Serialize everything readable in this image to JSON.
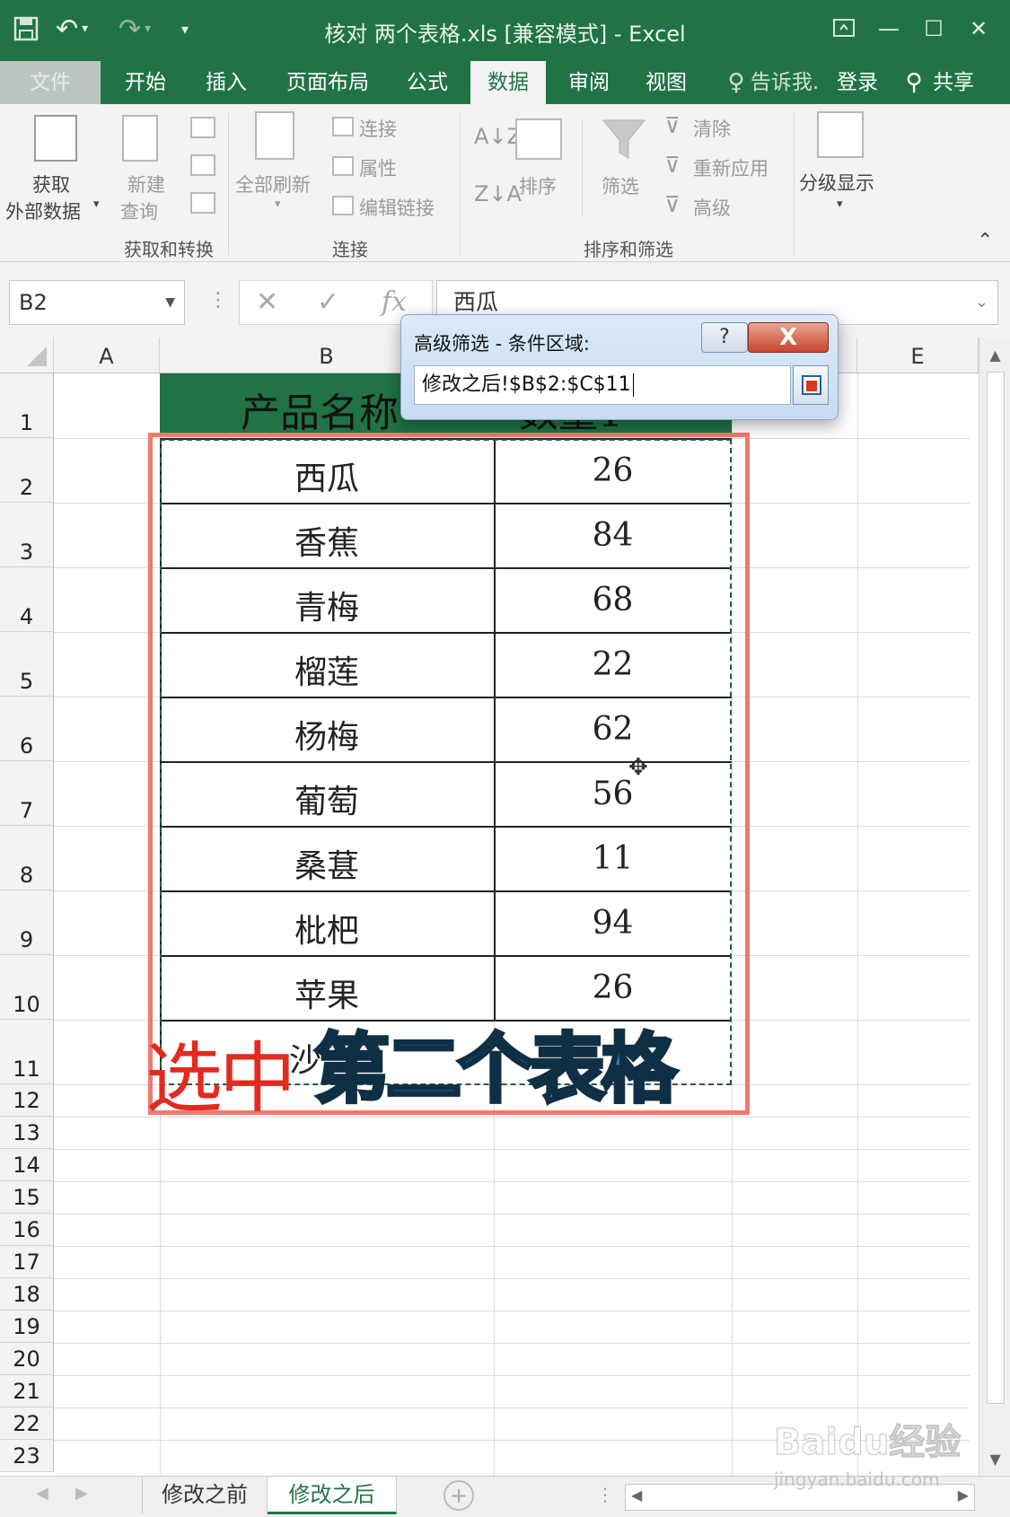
{
  "window": {
    "title": "核对 两个表格.xls  [兼容模式] - Excel",
    "controls": [
      "restore-icon",
      "minimize-icon",
      "maximize-icon",
      "close-icon"
    ]
  },
  "ribbon_tabs": [
    {
      "label": "文件",
      "state": "file"
    },
    {
      "label": "开始"
    },
    {
      "label": "插入"
    },
    {
      "label": "页面布局"
    },
    {
      "label": "公式"
    },
    {
      "label": "数据",
      "state": "active"
    },
    {
      "label": "审阅"
    },
    {
      "label": "视图"
    }
  ],
  "tell_me": "告诉我.",
  "login": "登录",
  "share": "共享",
  "ribbon": {
    "get_external": [
      "获取",
      "外部数据"
    ],
    "new_query": [
      "新建",
      "查询"
    ],
    "group_get_transform": "获取和转换",
    "refresh_all": "全部刷新",
    "connections": "连接",
    "properties": "属性",
    "edit_links": "编辑链接",
    "group_connections": "连接",
    "sort": "排序",
    "filter": "筛选",
    "clear": "清除",
    "reapply": "重新应用",
    "advanced": "高级",
    "group_sort_filter": "排序和筛选",
    "outline": "分级显示"
  },
  "formula_bar": {
    "name_box": "B2",
    "content": "西瓜",
    "fx": "fx"
  },
  "columns": [
    "A",
    "B",
    "C",
    "D",
    "E"
  ],
  "rows": [
    "1",
    "2",
    "3",
    "4",
    "5",
    "6",
    "7",
    "8",
    "9",
    "10",
    "11",
    "12",
    "13",
    "14",
    "15",
    "16",
    "17",
    "18",
    "19",
    "20",
    "21",
    "22",
    "23"
  ],
  "table": {
    "header_name": "产品名称",
    "header_qty": "数量1",
    "rows": [
      {
        "name": "西瓜",
        "qty": "26"
      },
      {
        "name": "香蕉",
        "qty": "84"
      },
      {
        "name": "青梅",
        "qty": "68"
      },
      {
        "name": "榴莲",
        "qty": "22"
      },
      {
        "name": "杨梅",
        "qty": "62"
      },
      {
        "name": "葡萄",
        "qty": "56"
      },
      {
        "name": "桑葚",
        "qty": "11"
      },
      {
        "name": "枇杷",
        "qty": "94"
      },
      {
        "name": "苹果",
        "qty": "26"
      },
      {
        "name": "沙",
        "qty": ""
      }
    ]
  },
  "dialog": {
    "title": "高级筛选 - 条件区域:",
    "help": "?",
    "close": "X",
    "value": "修改之后!$B$2:$C$11"
  },
  "overlay": {
    "red_text": "选中",
    "blue_text": "第二个表格"
  },
  "sheets": [
    "修改之前",
    "修改之后"
  ],
  "active_sheet": "修改之后",
  "watermark": {
    "logo": "Baidu经验",
    "url": "jingyan.baidu.com"
  }
}
